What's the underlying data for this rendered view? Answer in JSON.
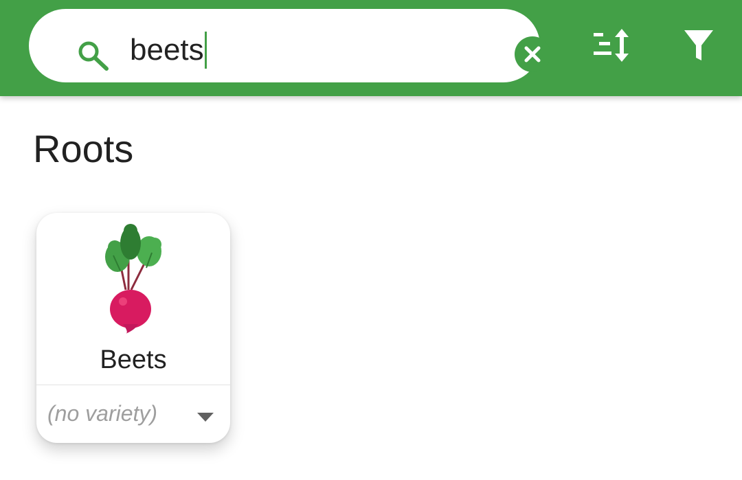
{
  "search": {
    "query": "beets",
    "icon": "search-icon",
    "clear_icon": "clear-icon"
  },
  "toolbar": {
    "sort_icon": "sort-icon",
    "filter_icon": "filter-icon"
  },
  "colors": {
    "primary": "#43a047",
    "background": "#ffffff",
    "beet_root": "#d81b60",
    "beet_leaf": "#43a047"
  },
  "section": {
    "title": "Roots"
  },
  "cards": [
    {
      "name": "Beets",
      "image": "beet-icon",
      "variety": "(no variety)"
    }
  ]
}
